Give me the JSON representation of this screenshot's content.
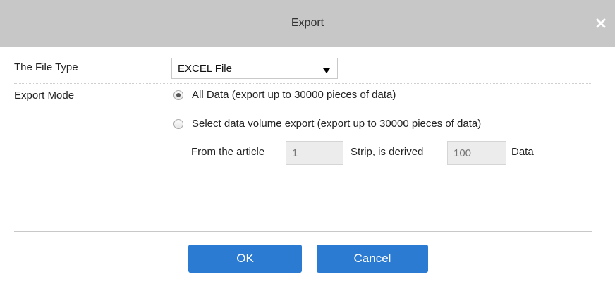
{
  "dialog": {
    "title": "Export"
  },
  "file_type": {
    "label": "The File Type",
    "selected": "EXCEL File"
  },
  "export_mode": {
    "label": "Export Mode",
    "option_all": "All Data (export up to 30000 pieces of data)",
    "option_select": "Select data volume export (export up to 30000 pieces of data)",
    "selected": "all"
  },
  "range": {
    "from_label": "From the article",
    "from_value": "1",
    "strip_label": "Strip, is derived",
    "count_value": "100",
    "data_label": "Data"
  },
  "buttons": {
    "ok": "OK",
    "cancel": "Cancel"
  },
  "colors": {
    "titlebar": "#c7c7c7",
    "button": "#2b7bd3"
  }
}
